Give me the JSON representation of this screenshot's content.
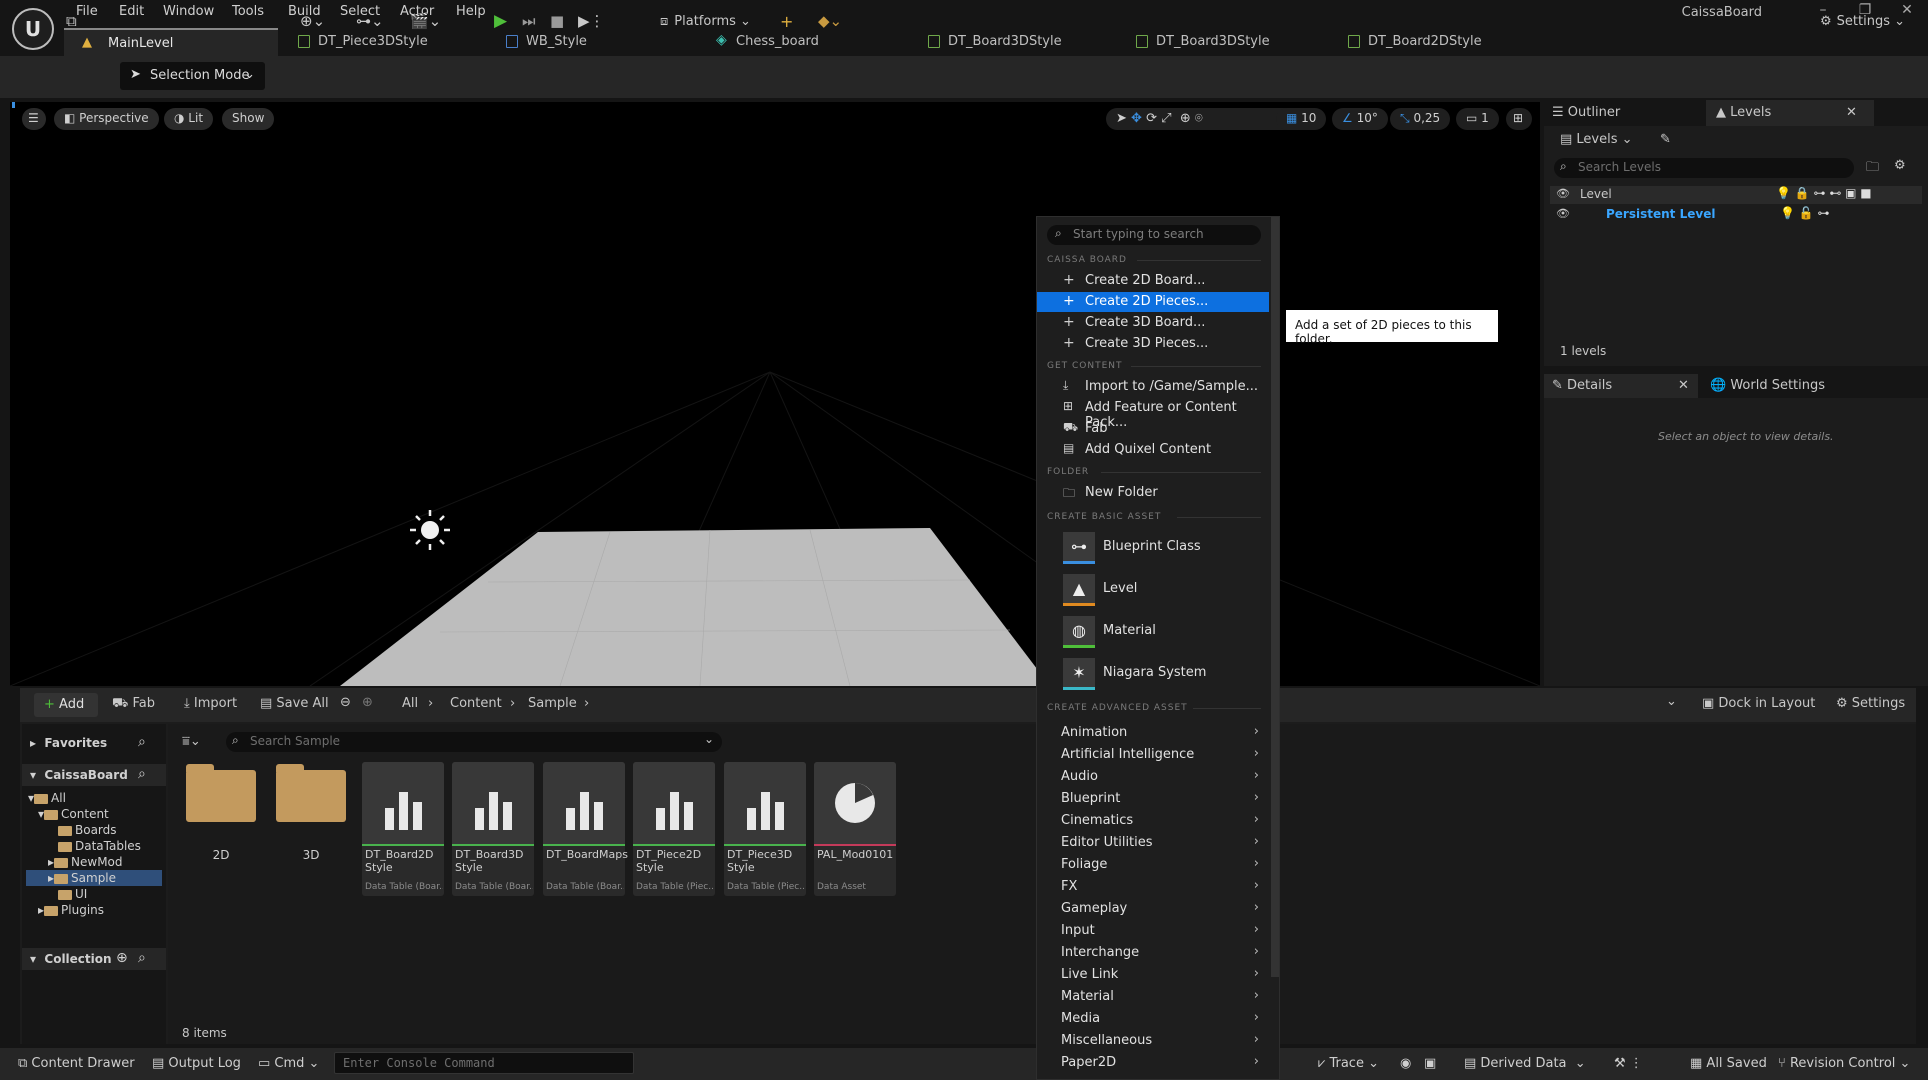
{
  "app": {
    "project": "CaissaBoard"
  },
  "menu": [
    "File",
    "Edit",
    "Window",
    "Tools",
    "Build",
    "Select",
    "Actor",
    "Help"
  ],
  "tabs": [
    {
      "label": "MainLevel"
    },
    {
      "label": "DT_Piece3DStyle"
    },
    {
      "label": "WB_Style"
    },
    {
      "label": "Chess_board"
    },
    {
      "label": "DT_Board3DStyle"
    },
    {
      "label": "DT_Board3DStyle"
    },
    {
      "label": "DT_Board2DStyle"
    }
  ],
  "toolbar": {
    "selection_mode": "Selection Mode",
    "platforms": "Platforms",
    "settings": "Settings"
  },
  "viewport": {
    "perspective": "Perspective",
    "lit": "Lit",
    "show": "Show",
    "grid": "10",
    "angle": "10°",
    "scale": "0,25",
    "camera": "1"
  },
  "outliner": {
    "tab1": "Outliner",
    "tab2": "Levels",
    "levels_btn": "Levels",
    "search_placeholder": "Search Levels",
    "col_level": "Level",
    "persistent": "Persistent Level",
    "count": "1 levels"
  },
  "details": {
    "tab1": "Details",
    "tab2": "World Settings",
    "empty": "Select an object to view details."
  },
  "content_browser": {
    "add": "Add",
    "fab": "Fab",
    "import": "Import",
    "save_all": "Save All",
    "path": [
      "All",
      "Content",
      "Sample"
    ],
    "dock": "Dock in Layout",
    "settings": "Settings",
    "favorites": "Favorites",
    "project": "CaissaBoard",
    "collection": "Collection",
    "tree": [
      "All",
      "Content",
      "Boards",
      "DataTables",
      "NewMod",
      "Sample",
      "UI",
      "Plugins"
    ],
    "search_placeholder": "Search Sample",
    "folders": [
      "2D",
      "3D"
    ],
    "assets": [
      {
        "name": "DT_Board2D Style",
        "type": "Data Table (Boar..."
      },
      {
        "name": "DT_Board3D Style",
        "type": "Data Table (Boar..."
      },
      {
        "name": "DT_BoardMaps",
        "type": "Data Table (Boar..."
      },
      {
        "name": "DT_Piece2D Style",
        "type": "Data Table (Piec..."
      },
      {
        "name": "DT_Piece3D Style",
        "type": "Data Table (Piec..."
      },
      {
        "name": "PAL_Mod0101",
        "type": "Data Asset"
      }
    ],
    "count": "8 items"
  },
  "context_menu": {
    "search_placeholder": "Start typing to search",
    "sec_caissa": "CAISSA BOARD",
    "caissa": [
      "Create 2D Board...",
      "Create 2D Pieces...",
      "Create 3D Board...",
      "Create 3D Pieces..."
    ],
    "sec_get": "GET CONTENT",
    "get": [
      "Import to /Game/Sample...",
      "Add Feature or Content Pack...",
      "Fab",
      "Add Quixel Content"
    ],
    "sec_folder": "FOLDER",
    "folder": [
      "New Folder"
    ],
    "sec_basic": "CREATE BASIC ASSET",
    "basic": [
      "Blueprint Class",
      "Level",
      "Material",
      "Niagara System"
    ],
    "sec_adv": "CREATE ADVANCED ASSET",
    "advanced": [
      "Animation",
      "Artificial Intelligence",
      "Audio",
      "Blueprint",
      "Cinematics",
      "Editor Utilities",
      "Foliage",
      "FX",
      "Gameplay",
      "Input",
      "Interchange",
      "Live Link",
      "Material",
      "Media",
      "Miscellaneous",
      "Paper2D"
    ]
  },
  "tooltip": "Add a set of 2D pieces to this folder.",
  "statusbar": {
    "drawer": "Content Drawer",
    "output": "Output Log",
    "cmd": "Cmd",
    "console_placeholder": "Enter Console Command",
    "trace": "Trace",
    "derived": "Derived Data",
    "saved": "All Saved",
    "revision": "Revision Control"
  },
  "colors": {
    "accent": "#0d70e0",
    "play": "#4fbf3a",
    "folder": "#c39a5e"
  }
}
